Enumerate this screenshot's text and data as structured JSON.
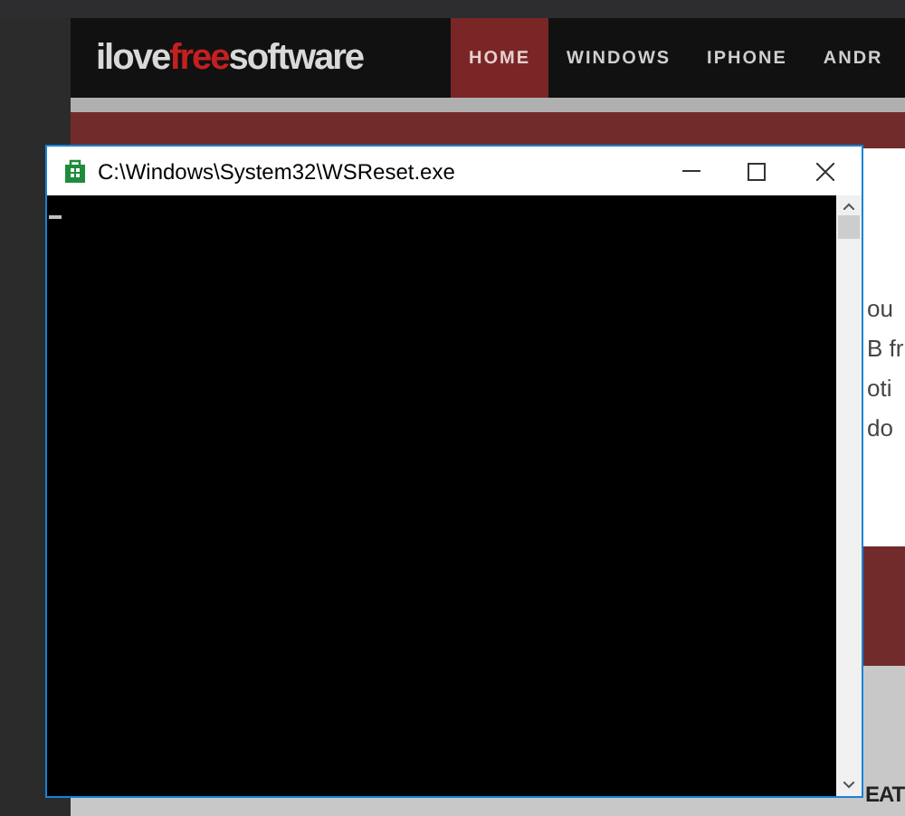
{
  "website": {
    "logo": [
      {
        "text": "ilove",
        "kind": "plain"
      },
      {
        "text": "free",
        "kind": "accent"
      },
      {
        "text": "software",
        "kind": "plain"
      }
    ],
    "nav": [
      {
        "label": "HOME",
        "selected": true
      },
      {
        "label": "WINDOWS",
        "selected": false
      },
      {
        "label": "IPHONE",
        "selected": false
      },
      {
        "label": "ANDR",
        "selected": false
      }
    ],
    "article_lines": [
      "ou",
      "B fr",
      "oti",
      "do"
    ],
    "section_heading": "EAT"
  },
  "console": {
    "title": "C:\\Windows\\System32\\WSReset.exe"
  }
}
